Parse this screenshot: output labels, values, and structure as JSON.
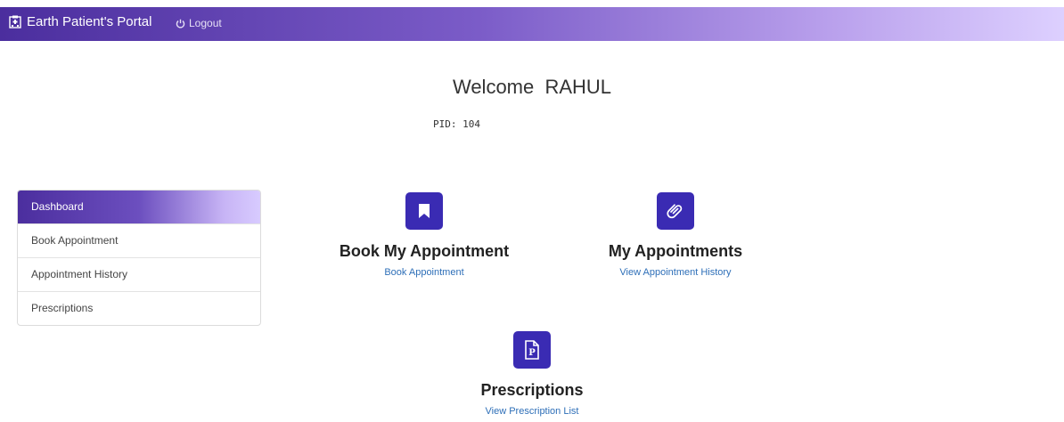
{
  "navbar": {
    "brand": "Earth Patient's Portal",
    "logout": "Logout"
  },
  "welcome": {
    "greeting": "Welcome  RAHUL",
    "pid": "PID: 104"
  },
  "sidebar": {
    "items": [
      {
        "label": "Dashboard",
        "active": true
      },
      {
        "label": "Book Appointment"
      },
      {
        "label": "Appointment History"
      },
      {
        "label": "Prescriptions"
      }
    ]
  },
  "cards": {
    "book": {
      "icon": "bookmark-icon",
      "title": "Book My Appointment",
      "link": "Book Appointment"
    },
    "appointments": {
      "icon": "paperclip-icon",
      "title": "My Appointments",
      "link": "View Appointment History"
    },
    "prescriptions": {
      "icon": "prescription-file-icon",
      "title": "Prescriptions",
      "link": "View Prescription List"
    }
  },
  "colors": {
    "accent": "#3a2bb3",
    "link": "#2e6fb8",
    "nav_start": "#4b2e9e",
    "nav_end": "#ddd0ff"
  }
}
